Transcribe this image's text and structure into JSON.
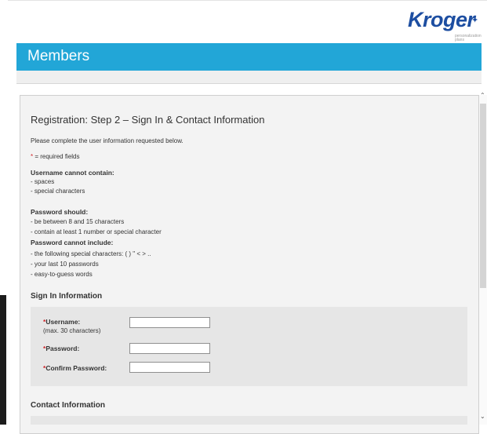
{
  "brand": {
    "logo_text": "Kroger",
    "tagline": "personalization plans"
  },
  "header": {
    "title": "Members"
  },
  "page": {
    "title": "Registration: Step 2 – Sign In & Contact Information",
    "intro": "Please complete the user information requested below.",
    "required_mark": "*",
    "required_note": " = required fields",
    "username_rules_heading": "Username cannot contain:",
    "username_rules": [
      "- spaces",
      "- special characters"
    ],
    "password_should_heading": "Password should:",
    "password_should": [
      "- be between 8 and 15 characters",
      "- contain at least 1 number or special character"
    ],
    "password_cannot_heading": "Password cannot include:",
    "password_cannot": [
      "- the following special characters: ( ) \" < > ..",
      "- your last 10 passwords",
      "- easy-to-guess words"
    ]
  },
  "sign_in": {
    "heading": "Sign In Information",
    "username_label": "Username:",
    "username_hint": "(max. 30 characters)",
    "password_label": "Password:",
    "confirm_label": "Confirm Password:",
    "username_value": "",
    "password_value": "",
    "confirm_value": ""
  },
  "contact": {
    "heading": "Contact Information"
  },
  "colors": {
    "banner": "#22a6d7",
    "required": "#d0262a",
    "logo": "#1d4ea1"
  }
}
